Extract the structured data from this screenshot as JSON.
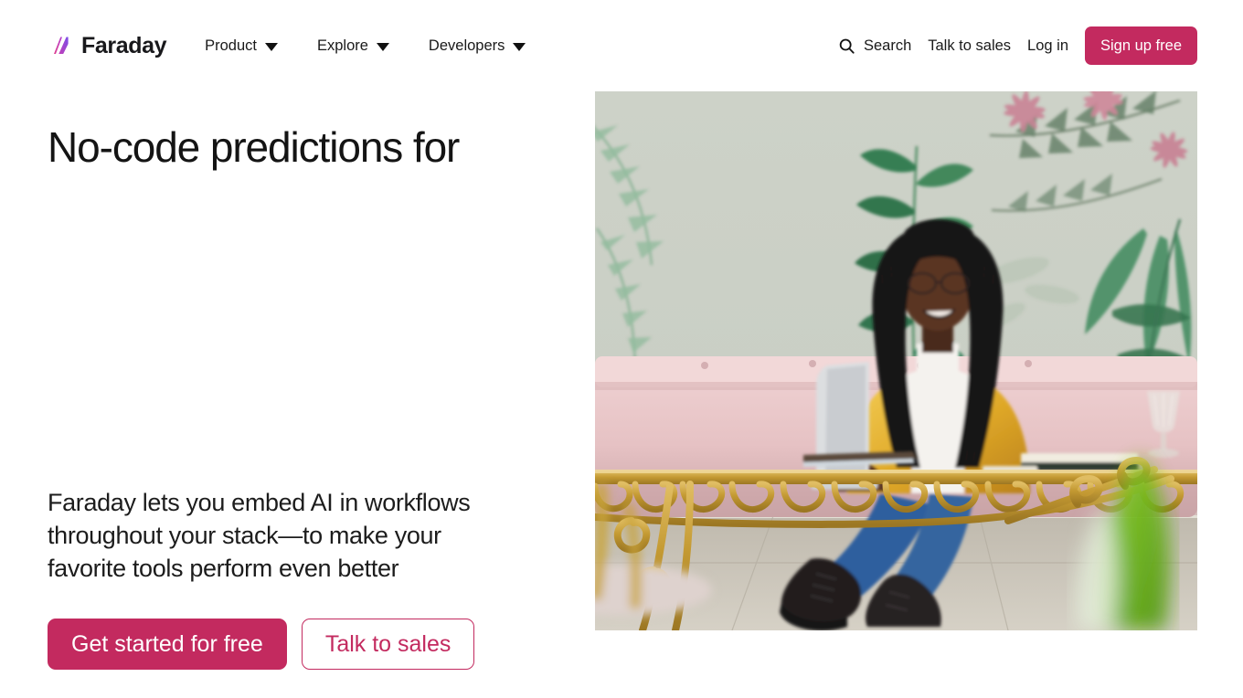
{
  "brand": {
    "name": "Faraday",
    "logo_icon": "faraday-slash-mark",
    "accent_color": "#c32a5f",
    "logo_gradient_start": "#e8458f",
    "logo_gradient_end": "#8b4ae0"
  },
  "nav": {
    "items": [
      {
        "label": "Product",
        "icon": "chevron-down-icon",
        "has_dropdown": true
      },
      {
        "label": "Explore",
        "icon": "chevron-down-icon",
        "has_dropdown": true
      },
      {
        "label": "Developers",
        "icon": "chevron-down-icon",
        "has_dropdown": true
      }
    ],
    "search_label": "Search",
    "search_icon": "search-icon",
    "talk_to_sales_label": "Talk to sales",
    "login_label": "Log in",
    "signup_label": "Sign up free"
  },
  "hero": {
    "headline": "No-code predictions for",
    "headline_rotating_word": "",
    "subhead": "Faraday lets you embed AI in workflows throughout your stack—to make your favorite tools perform even better",
    "cta_primary": "Get started for free",
    "cta_secondary": "Talk to sales",
    "image": {
      "alt": "Smiling woman with braided hair and glasses working on a laptop at an ornate gold table in front of botanical wallpaper",
      "subject": "woman-at-laptop",
      "wallpaper": "botanical-leaves-and-pink-flowers",
      "furniture": "gold-scrollwork-table-and-pink-tufted-sofa",
      "colors": {
        "wall": "#ccd1c7",
        "leaf_green": "#3f7a56",
        "leaf_light": "#87b49a",
        "flower_pink": "#d9808f",
        "gold": "#c69a35",
        "sofa_pink": "#e7c4c6",
        "jacket_yellow": "#e8b53a",
        "jeans_blue": "#2f5f9e",
        "boot_black": "#231f20",
        "floor": "#cfc9bd",
        "foreground_leaf": "#6fbd1c"
      }
    }
  }
}
